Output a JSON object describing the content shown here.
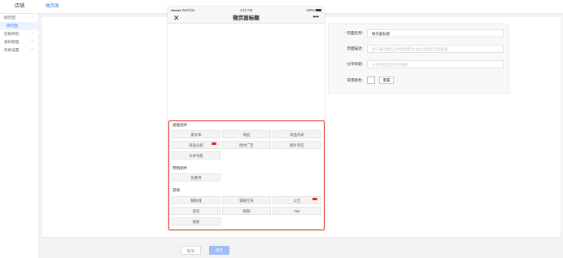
{
  "header": {
    "brand": "店铺",
    "breadcrumb": "微页面"
  },
  "sidebar": {
    "items": [
      {
        "label": "微页面",
        "chevron": "﹀"
      },
      {
        "label": "微页面"
      },
      {
        "label": "店铺导航",
        "chevron": "﹀"
      },
      {
        "label": "素材管理",
        "chevron": "﹀"
      },
      {
        "label": "风格设置",
        "chevron": "﹀"
      }
    ]
  },
  "phone": {
    "status_left": "●●●●● WeChat ",
    "status_time": "1:21 AM",
    "status_right": "100%",
    "close": "✕",
    "title": "微页面标题",
    "more": "•••"
  },
  "components": {
    "groups": [
      {
        "title": "基础组件",
        "items": [
          "富文本",
          "商品",
          "商品列表",
          "商品分组",
          "图文广告",
          "图片热区",
          "文本导航"
        ]
      },
      {
        "title": "营销组件",
        "items": [
          "优惠券"
        ]
      },
      {
        "title": "其他",
        "items": [
          "辅助线",
          "辅助空白",
          "公告",
          "语音",
          "视频",
          "Tab",
          "搜索"
        ]
      }
    ]
  },
  "form": {
    "name_label": "页面名称:",
    "name_value": "微页面标题",
    "desc_label": "页面描述:",
    "desc_placeholder": "用户通过微信分享给朋友时,会自动显示页面描述",
    "share_label": "分享标题:",
    "share_placeholder": "分享时会显示分享标题",
    "bg_label": "背景颜色:",
    "reset_label": "重置"
  },
  "footer": {
    "cancel": "取消",
    "save": "保存"
  },
  "colors": {
    "accent": "#2e7bff",
    "highlight_border": "#e0261a",
    "save_bg": "#9dbef5"
  }
}
